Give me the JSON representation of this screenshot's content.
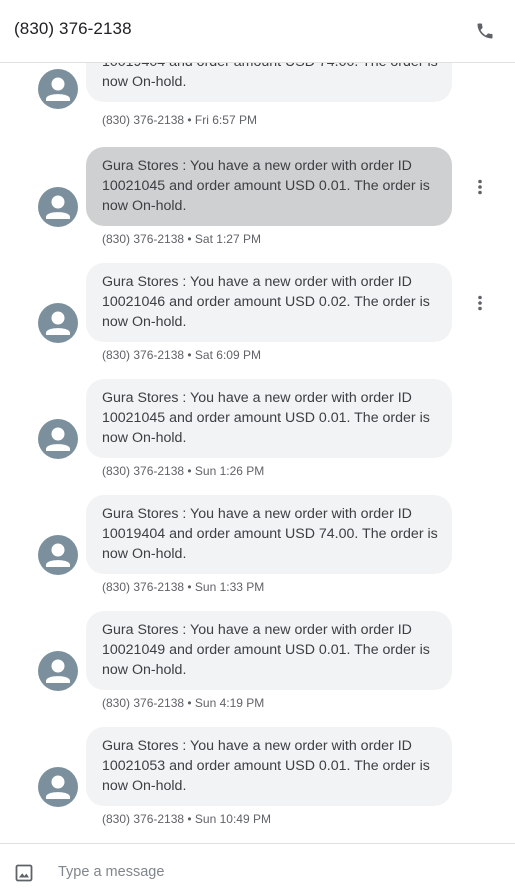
{
  "header": {
    "title": "(830) 376-2138",
    "call_icon": "phone-icon"
  },
  "messages": [
    {
      "text": "10019404 and order amount USD 74.00. The order is now On-hold.",
      "meta": "(830) 376-2138 • Fri 6:57 PM",
      "selected": false,
      "show_more": false
    },
    {
      "text": "Gura Stores : You have a new order with order ID 10021045 and order amount USD 0.01. The order is now On-hold.",
      "meta": "(830) 376-2138 • Sat 1:27 PM",
      "selected": true,
      "show_more": true
    },
    {
      "text": "Gura Stores : You have a new order with order ID 10021046 and order amount USD 0.02. The order is now On-hold.",
      "meta": "(830) 376-2138 • Sat 6:09 PM",
      "selected": false,
      "show_more": true
    },
    {
      "text": "Gura Stores : You have a new order with order ID 10021045 and order amount USD 0.01. The order is now On-hold.",
      "meta": "(830) 376-2138 • Sun 1:26 PM",
      "selected": false,
      "show_more": false
    },
    {
      "text": "Gura Stores : You have a new order with order ID 10019404 and order amount USD 74.00. The order is now On-hold.",
      "meta": "(830) 376-2138 • Sun 1:33 PM",
      "selected": false,
      "show_more": false
    },
    {
      "text": "Gura Stores : You have a new order with order ID 10021049 and order amount USD 0.01. The order is now On-hold.",
      "meta": "(830) 376-2138 • Sun 4:19 PM",
      "selected": false,
      "show_more": false
    },
    {
      "text": "Gura Stores : You have a new order with order ID 10021053 and order amount USD 0.01. The order is now On-hold.",
      "meta": "(830) 376-2138 • Sun 10:49 PM",
      "selected": false,
      "show_more": false
    }
  ],
  "composer": {
    "placeholder": "Type a message",
    "value": "",
    "attach_icon": "image-icon"
  },
  "colors": {
    "avatar": "#7c8f9c",
    "bubble": "#f1f3f4",
    "bubble_selected": "#cfd0d1",
    "meta_text": "#5f6368"
  }
}
